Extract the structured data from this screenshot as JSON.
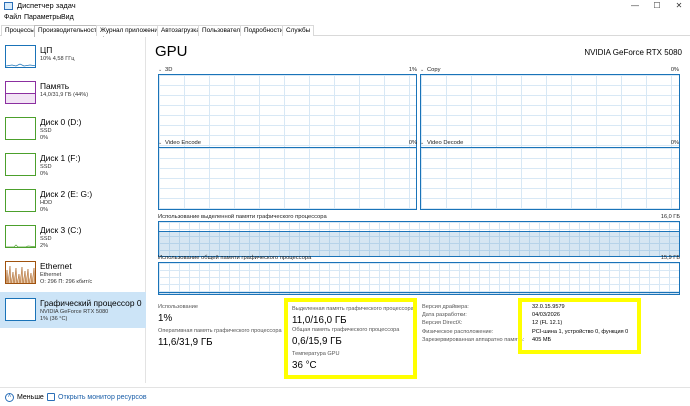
{
  "window": {
    "title": "Диспетчер задач"
  },
  "menu": [
    "Файл",
    "Параметры",
    "Вид"
  ],
  "tabs": [
    "Процессы",
    "Производительность",
    "Журнал приложений",
    "Автозагрузка",
    "Пользователи",
    "Подробности",
    "Службы"
  ],
  "active_tab": "Производительность",
  "sidebar": {
    "items": [
      {
        "title": "ЦП",
        "sub1": "10%  4,58 ГГц",
        "sub2": "",
        "color": "#1a73b8"
      },
      {
        "title": "Память",
        "sub1": "14,0/31,9 ГБ (44%)",
        "sub2": "",
        "color": "#8b2fa0"
      },
      {
        "title": "Диск 0 (D:)",
        "sub1": "SSD",
        "sub2": "0%",
        "color": "#4ca02c"
      },
      {
        "title": "Диск 1 (F:)",
        "sub1": "SSD",
        "sub2": "0%",
        "color": "#4ca02c"
      },
      {
        "title": "Диск 2 (E: G:)",
        "sub1": "HDD",
        "sub2": "0%",
        "color": "#4ca02c"
      },
      {
        "title": "Диск 3 (C:)",
        "sub1": "SSD",
        "sub2": "2%",
        "color": "#4ca02c"
      },
      {
        "title": "Ethernet",
        "sub1": "Ethernet",
        "sub2": "О: 296 П: 296 кбит/с",
        "color": "#a0520e"
      },
      {
        "title": "Графический процессор 0",
        "sub1": "NVIDIA GeForce RTX 5080",
        "sub2": "1% (36 °C)",
        "color": "#1a73b8"
      }
    ]
  },
  "main": {
    "title": "GPU",
    "gpu_name": "NVIDIA GeForce RTX 5080",
    "graphs": [
      {
        "label": "3D",
        "pct": "1%"
      },
      {
        "label": "Copy",
        "pct": "0%"
      },
      {
        "label": "Video Encode",
        "pct": "0%"
      },
      {
        "label": "Video Decode",
        "pct": "0%"
      }
    ],
    "dedicated_graph": {
      "label": "Использование выделенной памяти графического процессора",
      "max": "16,0 ГБ"
    },
    "shared_graph": {
      "label": "Использование общей памяти графического процессора",
      "max": "15,9 ГБ"
    },
    "stats": {
      "usage_label": "Использование",
      "usage_value": "1%",
      "gpu_mem_label": "Оперативная память графического процессора",
      "gpu_mem_value": "11,6/31,9 ГБ",
      "dedicated_label": "Выделенная память графического процессора",
      "dedicated_value": "11,0/16,0 ГБ",
      "shared_label": "Общая память графического процессора",
      "shared_value": "0,6/15,9 ГБ",
      "temp_label": "Температура GPU",
      "temp_value": "36 °C"
    },
    "info": [
      {
        "key": "Версия драйвера:",
        "value": "32.0.15.9579"
      },
      {
        "key": "Дата разработки:",
        "value": "04/03/2026"
      },
      {
        "key": "Версия DirectX:",
        "value": "12 (FL 12.1)"
      },
      {
        "key": "Физическое расположение:",
        "value": "PCI-шина 1, устройство 0, функция 0"
      },
      {
        "key": "Зарезервированная аппаратно память:",
        "value": "405 МБ"
      }
    ]
  },
  "footer": {
    "less_label": "Меньше",
    "monitor_link": "Открыть монитор ресурсов"
  },
  "colors": {
    "graph_blue": "#1a73b8",
    "highlight": "#ffff00",
    "selected_bg": "#cce4f7"
  }
}
